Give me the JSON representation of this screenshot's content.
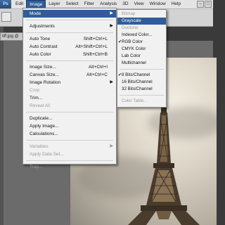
{
  "menubar": {
    "app_logo": "Ps",
    "items": [
      "Edit",
      "Image",
      "Layer",
      "Select",
      "Filter",
      "Analysis",
      "3D",
      "View",
      "Window",
      "Help"
    ],
    "active_index": 1
  },
  "document_tab": "tiff.jpg @",
  "image_menu": {
    "mode": "Mode",
    "adjustments": "Adjustments",
    "auto_tone": "Auto Tone",
    "auto_tone_shortcut": "Shift+Ctrl+L",
    "auto_contrast": "Auto Contrast",
    "auto_contrast_shortcut": "Alt+Shift+Ctrl+L",
    "auto_color": "Auto Color",
    "auto_color_shortcut": "Shift+Ctrl+B",
    "image_size": "Image Size...",
    "image_size_shortcut": "Alt+Ctrl+I",
    "canvas_size": "Canvas Size...",
    "canvas_size_shortcut": "Alt+Ctrl+C",
    "image_rotation": "Image Rotation",
    "crop": "Crop",
    "trim": "Trim...",
    "reveal_all": "Reveal All",
    "duplicate": "Duplicate...",
    "apply_image": "Apply Image...",
    "calculations": "Calculations...",
    "variables": "Variables",
    "apply_data_set": "Apply Data Set...",
    "trap": "Trap..."
  },
  "mode_submenu": {
    "bitmap": "Bitmap",
    "grayscale": "Grayscale",
    "duotone": "Duotone",
    "indexed_color": "Indexed Color...",
    "rgb_color": "RGB Color",
    "cmyk_color": "CMYK Color",
    "lab_color": "Lab Color",
    "multichannel": "Multichannel",
    "bits8": "8 Bits/Channel",
    "bits16": "16 Bits/Channel",
    "bits32": "32 Bits/Channel",
    "color_table": "Color Table...",
    "checked_mark": "✔"
  }
}
